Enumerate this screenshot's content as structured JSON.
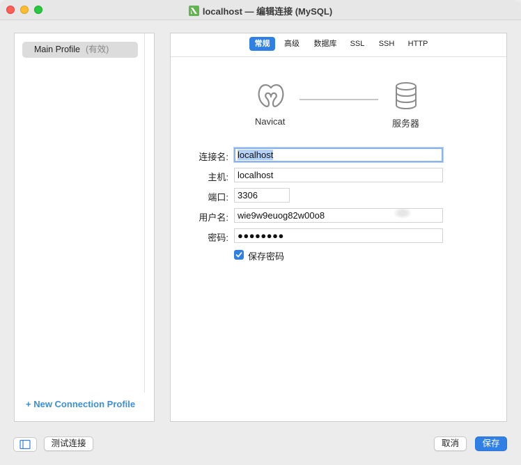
{
  "window": {
    "title": "localhost — 编辑连接 (MySQL)"
  },
  "sidebar": {
    "profiles": [
      {
        "name": "Main Profile",
        "note": "(有效)"
      }
    ],
    "new_profile_label": "+ New Connection Profile"
  },
  "tabs": [
    {
      "label": "常规",
      "active": true
    },
    {
      "label": "高级",
      "active": false
    },
    {
      "label": "数据库",
      "active": false
    },
    {
      "label": "SSL",
      "active": false
    },
    {
      "label": "SSH",
      "active": false
    },
    {
      "label": "HTTP",
      "active": false
    }
  ],
  "diagram": {
    "client_label": "Navicat",
    "server_label": "服务器",
    "client_icon": "navicat-logo-icon",
    "server_icon": "database-icon"
  },
  "form": {
    "connection_name": {
      "label": "连接名:",
      "value": "localhost"
    },
    "host": {
      "label": "主机:",
      "value": "localhost"
    },
    "port": {
      "label": "端口:",
      "value": "3306"
    },
    "username": {
      "label": "用户名:",
      "value": "wie9w9euog82w00o8"
    },
    "password": {
      "label": "密码:",
      "value": "●●●●●●●●"
    },
    "save_password": {
      "label": "保存密码",
      "checked": true
    }
  },
  "footer": {
    "test_button": "测试连接",
    "cancel_button": "取消",
    "save_button": "保存"
  },
  "colors": {
    "accent": "#2f7fe5",
    "link": "#3d8ed6"
  }
}
